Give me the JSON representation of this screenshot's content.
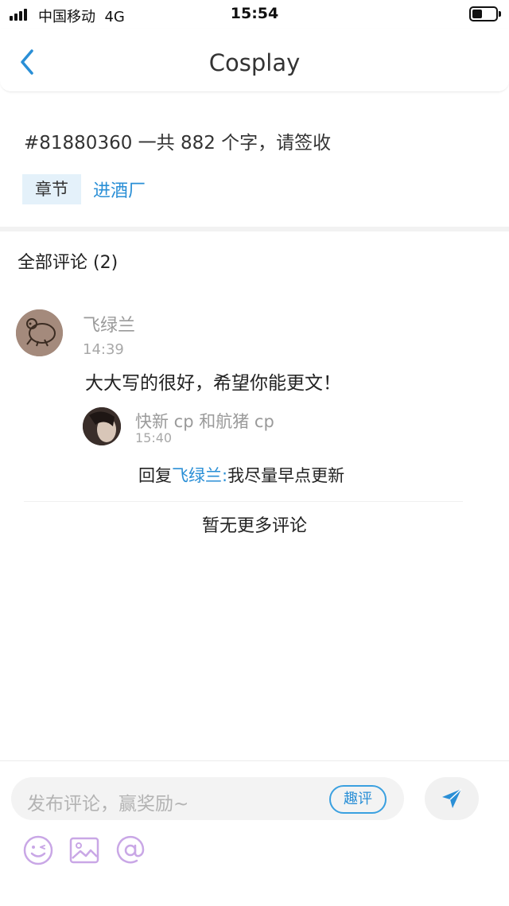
{
  "status_bar": {
    "carrier": "中国移动",
    "network": "4G",
    "time": "15:54"
  },
  "nav": {
    "title": "Cosplay",
    "back_icon": "chevron-left-icon"
  },
  "post": {
    "title": "#81880360 一共 882 个字，请签收",
    "chapter_tag": "章节",
    "chapter_name": "进酒厂"
  },
  "comments": {
    "header": "全部评论 (2)",
    "items": [
      {
        "author": "飞绿兰",
        "time": "14:39",
        "text": "大大写的很好，希望你能更文！",
        "replies": [
          {
            "author": "快新 cp 和航猪 cp",
            "time": "15:40",
            "prefix": "回复",
            "mention": "飞绿兰:",
            "text": "我尽量早点更新"
          }
        ]
      }
    ],
    "no_more": "暂无更多评论"
  },
  "composer": {
    "placeholder": "发布评论，赢奖励~",
    "quping_label": "趣评",
    "send_icon": "send-icon",
    "tools": [
      "emoji-icon",
      "image-icon",
      "at-icon"
    ]
  },
  "colors": {
    "accent": "#2a8fd6",
    "tag_bg": "#e4f1fa",
    "tool_icon": "#c9a7e6"
  }
}
